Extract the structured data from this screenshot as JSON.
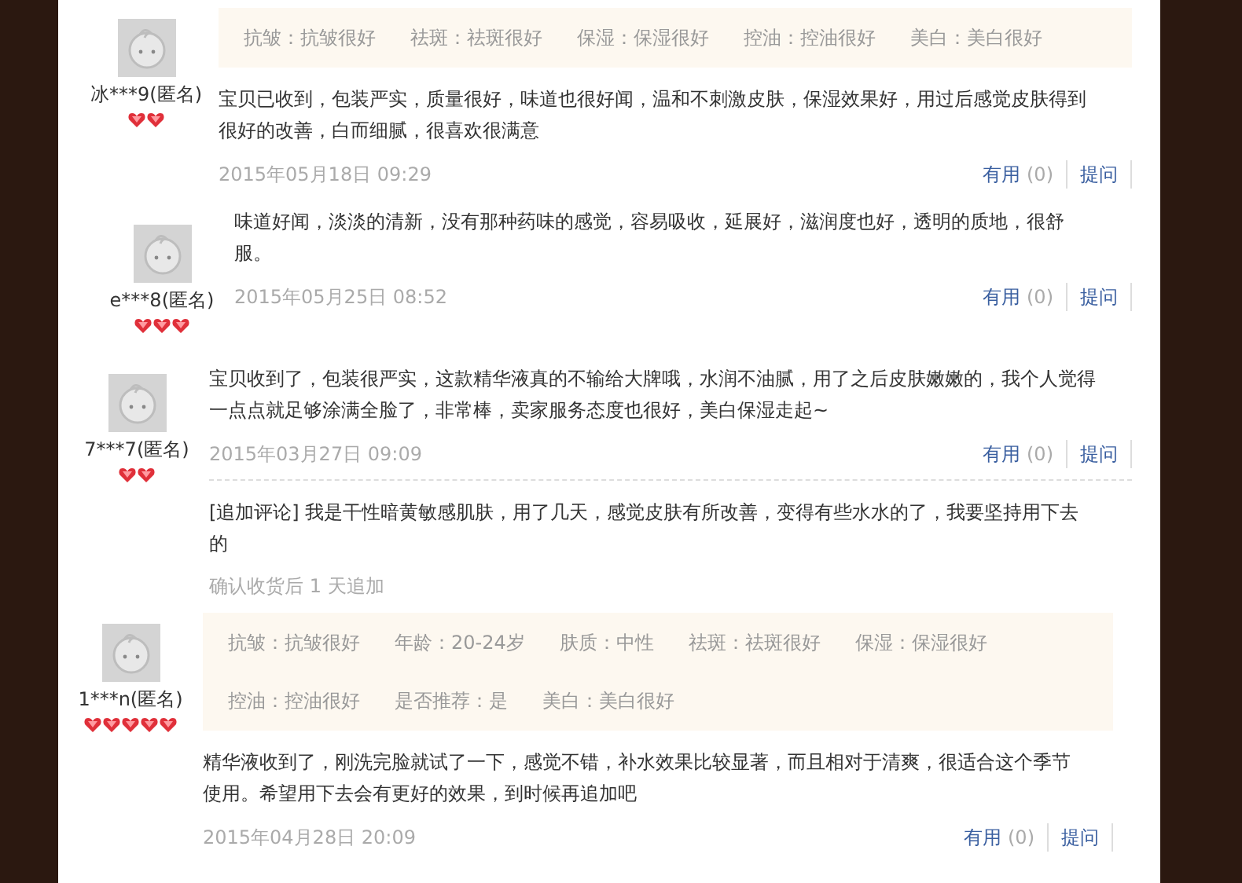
{
  "reviews": [
    {
      "user": "冰***9(匿名)",
      "rank": [
        {
          "kind": "heart"
        },
        {
          "kind": "heart"
        }
      ],
      "tags": [
        [
          "抗皱：抗皱很好",
          "祛斑：祛斑很好",
          "保湿：保湿很好",
          "控油：控油很好",
          "美白：美白很好"
        ]
      ],
      "text": "宝贝已收到，包装严实，质量很好，味道也很好闻，温和不刺激皮肤，保湿效果好，用过后感觉皮肤得到很好的改善，白而细腻，很喜欢很满意",
      "date": "2015年05月18日 09:29",
      "useful": "有用",
      "count": "(0)",
      "ask": "提问"
    },
    {
      "user": "e***8(匿名)",
      "rank": [
        {
          "kind": "heart"
        },
        {
          "kind": "heart"
        },
        {
          "kind": "heart"
        }
      ],
      "text": "味道好闻，淡淡的清新，没有那种药味的感觉，容易吸收，延展好，滋润度也好，透明的质地，很舒服。",
      "date": "2015年05月25日 08:52",
      "useful": "有用",
      "count": "(0)",
      "ask": "提问"
    },
    {
      "user": "7***7(匿名)",
      "rank": [
        {
          "kind": "heart"
        },
        {
          "kind": "heart"
        }
      ],
      "text": "宝贝收到了，包装很严实，这款精华液真的不输给大牌哦，水润不油腻，用了之后皮肤嫩嫩的，我个人觉得一点点就足够涂满全脸了，非常棒，卖家服务态度也很好，美白保湿走起~",
      "date": "2015年03月27日 09:09",
      "useful": "有用",
      "count": "(0)",
      "ask": "提问",
      "append": {
        "text": "[追加评论] 我是干性暗黄敏感肌肤，用了几天，感觉皮肤有所改善，变得有些水水的了，我要坚持用下去的",
        "note": "确认收货后 1 天追加"
      }
    },
    {
      "user": "1***n(匿名)",
      "rank": [
        {
          "kind": "heart"
        },
        {
          "kind": "heart"
        },
        {
          "kind": "heart"
        },
        {
          "kind": "heart"
        },
        {
          "kind": "heart"
        }
      ],
      "tags": [
        [
          "抗皱：抗皱很好",
          "年龄：20-24岁",
          "肤质：中性",
          "祛斑：祛斑很好",
          "保湿：保湿很好"
        ],
        [
          "控油：控油很好",
          "是否推荐：是",
          "美白：美白很好"
        ]
      ],
      "text": "精华液收到了，刚洗完脸就试了一下，感觉不错，补水效果比较显著，而且相对于清爽，很适合这个季节使用。希望用下去会有更好的效果，到时候再追加吧",
      "date": "2015年04月28日 20:09",
      "useful": "有用",
      "count": "(0)",
      "ask": "提问"
    }
  ]
}
